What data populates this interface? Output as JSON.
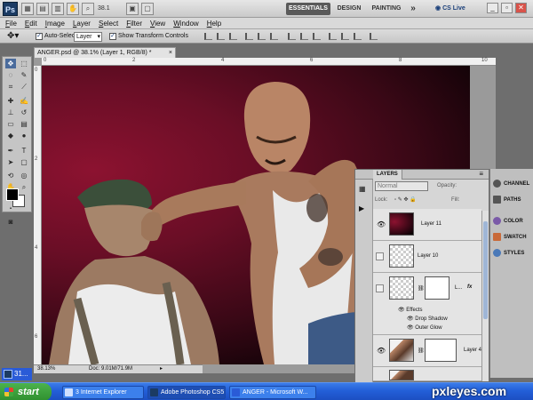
{
  "app": {
    "logo": "Ps",
    "zoom": "38.1",
    "workspaces": [
      "ESSENTIALS",
      "DESIGN",
      "PAINTING"
    ],
    "more": "»",
    "cs_live": "CS Live"
  },
  "menu": [
    "File",
    "Edit",
    "Image",
    "Layer",
    "Select",
    "Filter",
    "View",
    "Window",
    "Help"
  ],
  "options": {
    "auto_select_label": "Auto-Select:",
    "auto_select_value": "Layer",
    "transform_label": "Show Transform Controls"
  },
  "document": {
    "tab_title": "ANGER.psd @ 38.1% (Layer 1, RGB/8) *",
    "ruler_h": [
      "0",
      "2",
      "4",
      "6",
      "8",
      "10"
    ],
    "ruler_v": [
      "0",
      "2",
      "4",
      "6"
    ],
    "zoom_status": "38.13%",
    "doc_status": "Doc: 9.01M/71.9M"
  },
  "layers": {
    "tab": "LAYERS",
    "blend_mode": "Normal",
    "opacity_label": "Opacity:",
    "lock_label": "Lock:",
    "fill_label": "Fill:",
    "rows": [
      {
        "name": "Layer 11"
      },
      {
        "name": "Layer 10"
      },
      {
        "name": "L..."
      }
    ],
    "fx_label": "fx",
    "effects_label": "Effects",
    "effects": [
      "Drop Shadow",
      "Outer Glow"
    ],
    "layer4": "Layer 4"
  },
  "dock": [
    "CHANNEL",
    "PATHS",
    "COLOR",
    "SWATCH",
    "STYLES"
  ],
  "taskbar": {
    "start": "start",
    "tasks": [
      "3 Internet Explorer",
      "Adobe Photoshop CS5",
      "ANGER - Microsoft W..."
    ],
    "left_label": "31..."
  },
  "watermark": "pxleyes.com"
}
